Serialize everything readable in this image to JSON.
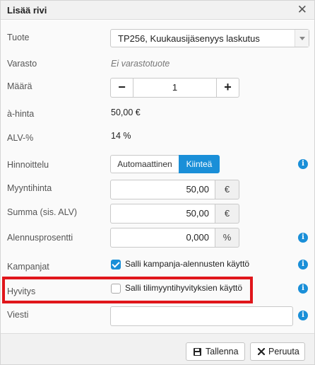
{
  "dialog": {
    "title": "Lisää rivi",
    "close_glyph": "✕"
  },
  "fields": {
    "product": {
      "label": "Tuote",
      "value": "TP256, Kuukausijäsenyys laskutus"
    },
    "warehouse": {
      "label": "Varasto",
      "value": "Ei varastotuote"
    },
    "quantity": {
      "label": "Määrä",
      "value": "1",
      "minus": "−",
      "plus": "+"
    },
    "unit_price": {
      "label": "à-hinta",
      "value": "50,00 €"
    },
    "vat": {
      "label": "ALV-%",
      "value": "14 %"
    },
    "pricing": {
      "label": "Hinnoittelu",
      "options": [
        "Automaattinen",
        "Kiinteä"
      ],
      "selected": "Kiinteä"
    },
    "sale_price": {
      "label": "Myyntihinta",
      "value": "50,00",
      "unit": "€"
    },
    "total": {
      "label": "Summa (sis. ALV)",
      "value": "50,00",
      "unit": "€"
    },
    "discount": {
      "label": "Alennusprosentti",
      "value": "0,000",
      "unit": "%"
    },
    "campaigns": {
      "label": "Kampanjat",
      "checkbox_label": "Salli kampanja-alennusten käyttö",
      "checked": true
    },
    "credits": {
      "label": "Hyvitys",
      "checkbox_label": "Salli tilimyyntihyvityksien käyttö",
      "checked": false
    },
    "message": {
      "label": "Viesti",
      "value": ""
    }
  },
  "footer": {
    "save_label": "Tallenna",
    "cancel_label": "Peruuta"
  },
  "info_glyph": "i",
  "colors": {
    "accent": "#1a8fd8",
    "highlight": "#e0161b"
  },
  "icons": [
    "close-icon",
    "chevron-down-icon",
    "info-icon",
    "save-icon",
    "cancel-icon",
    "checkmark-icon"
  ]
}
